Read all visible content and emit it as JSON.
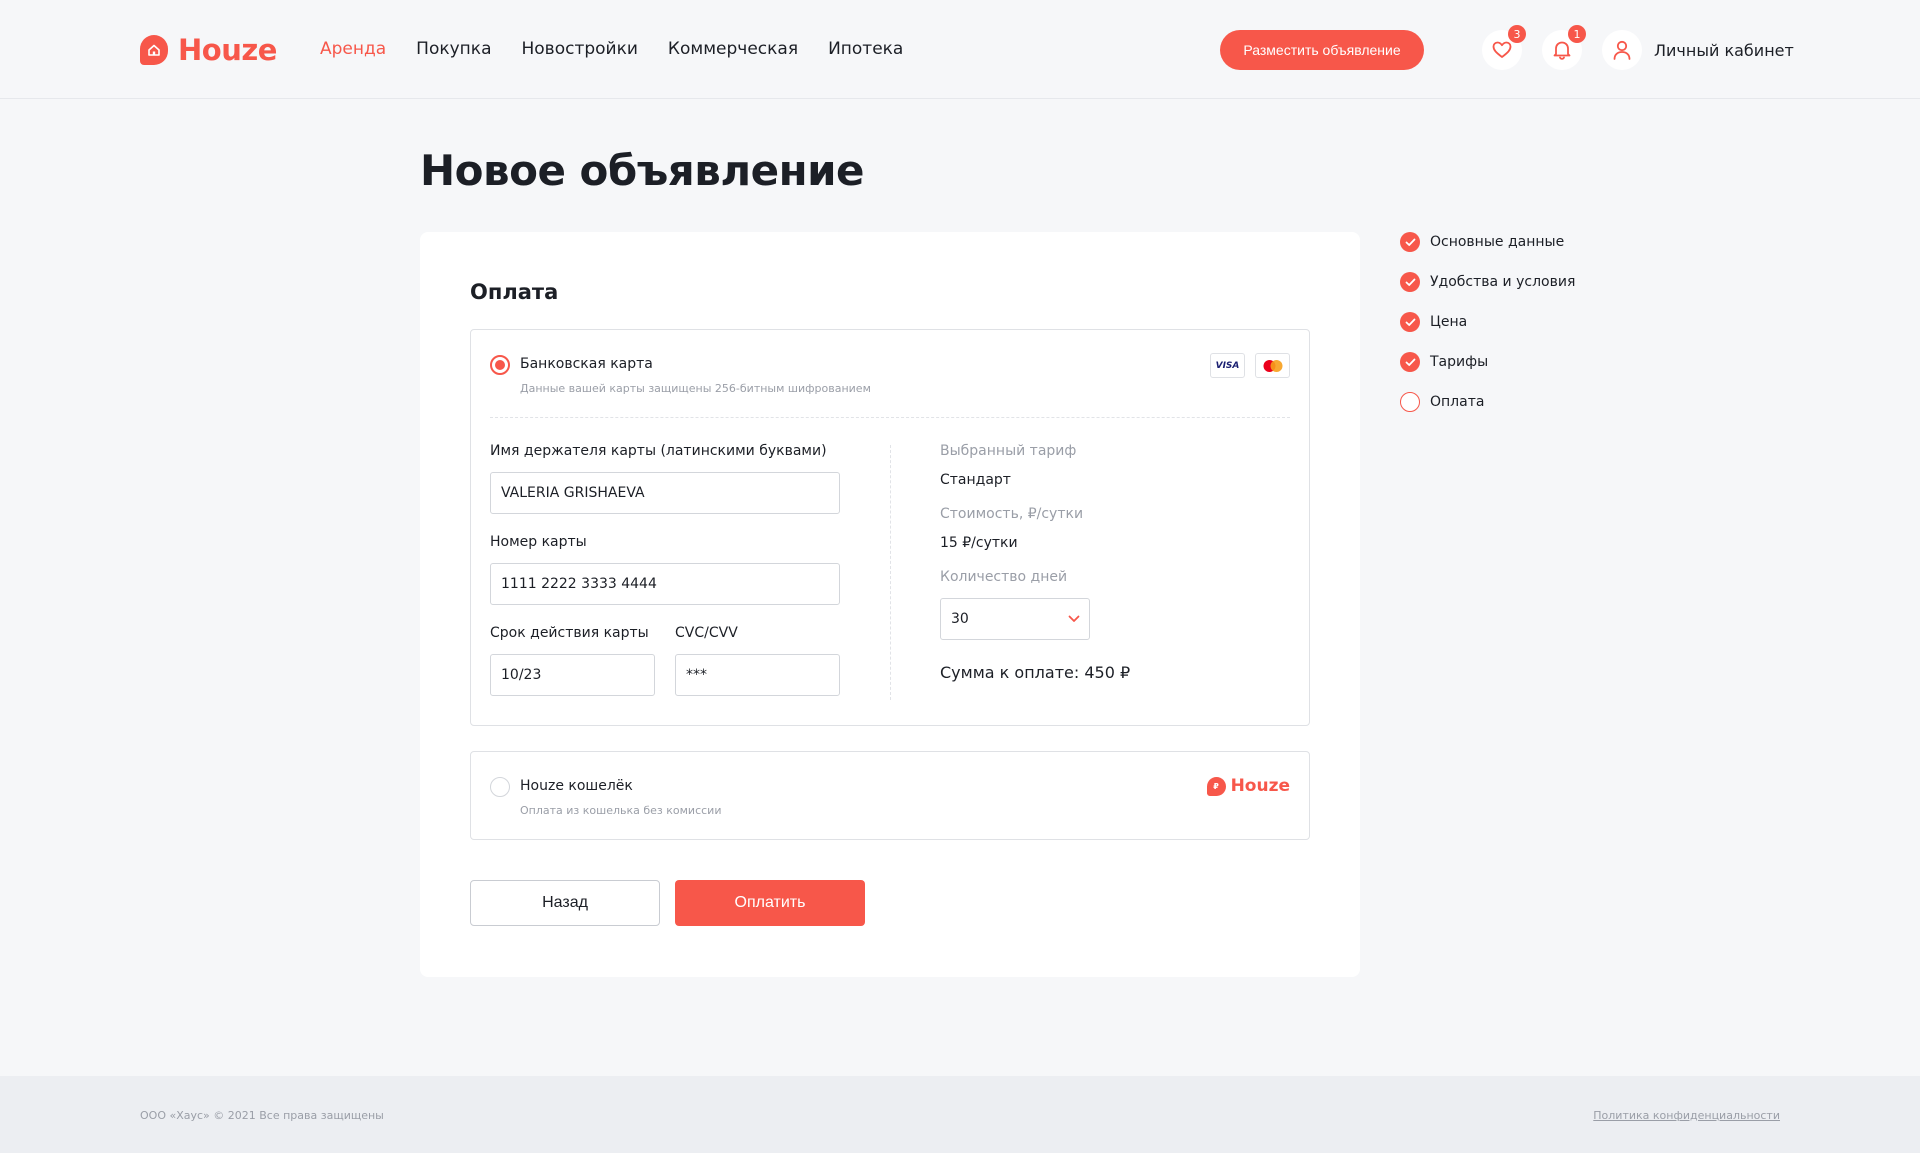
{
  "header": {
    "logo_text": "Houze",
    "nav": [
      "Аренда",
      "Покупка",
      "Новостройки",
      "Коммерческая",
      "Ипотека"
    ],
    "post_button": "Разместить объявление",
    "favorites_count": "3",
    "notifications_count": "1",
    "account_label": "Личный кабинет"
  },
  "page": {
    "title": "Новое объявление"
  },
  "payment": {
    "section_title": "Оплата",
    "card_option": {
      "title": "Банковская карта",
      "subtitle": "Данные вашей карты защищены 256-битным шифрованием",
      "visa_label": "VISA"
    },
    "form": {
      "holder_label": "Имя держателя карты (латинскими буквами)",
      "holder_value": "VALERIA GRISHAEVA",
      "number_label": "Номер карты",
      "number_value": "1111 2222 3333 4444",
      "expiry_label": "Срок действия карты",
      "expiry_value": "10/23",
      "cvc_label": "CVC/CVV",
      "cvc_value": "***"
    },
    "summary": {
      "tariff_label": "Выбранный тариф",
      "tariff_value": "Стандарт",
      "price_label": "Стоимость, ₽/сутки",
      "price_value": "15 ₽/сутки",
      "days_label": "Количество дней",
      "days_value": "30",
      "total": "Сумма к оплате: 450 ₽"
    },
    "wallet_option": {
      "title": "Houze кошелёк",
      "subtitle": "Оплата из кошелька без комиссии",
      "logo_text": "Houze",
      "logo_mark": "₽"
    },
    "back_button": "Назад",
    "pay_button": "Оплатить"
  },
  "steps": [
    {
      "label": "Основные данные",
      "done": true
    },
    {
      "label": "Удобства и условия",
      "done": true
    },
    {
      "label": "Цена",
      "done": true
    },
    {
      "label": "Тарифы",
      "done": true
    },
    {
      "label": "Оплата",
      "done": false
    }
  ],
  "footer": {
    "copyright": "ООО «Хаус» © 2021 Все права защищены",
    "privacy_link": "Политика конфиденциальности"
  },
  "colors": {
    "accent": "#f7574a",
    "background": "#f6f7f9"
  }
}
